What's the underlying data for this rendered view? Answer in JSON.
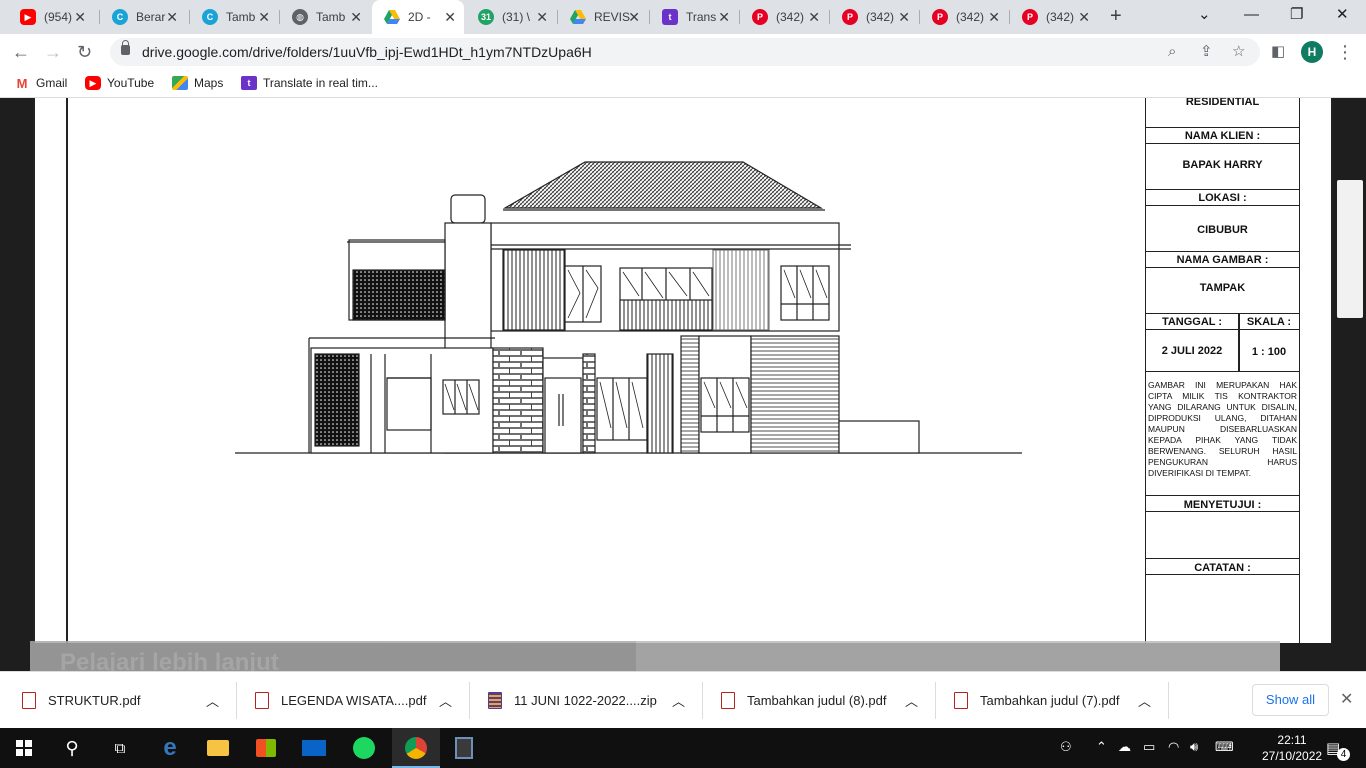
{
  "tabs": [
    {
      "title": "(954)",
      "icon": "youtube-icon",
      "color": "#ff0000"
    },
    {
      "title": "Berar",
      "icon": "canva-icon",
      "color": "#1aa3d6"
    },
    {
      "title": "Tamb",
      "icon": "canva-icon",
      "color": "#1aa3d6"
    },
    {
      "title": "Tamb",
      "icon": "globe-icon",
      "color": "#5f6368"
    },
    {
      "title": "2D -",
      "icon": "google-drive-icon",
      "color": "#1fa463",
      "active": true
    },
    {
      "title": "(31) \\",
      "icon": "calendar-icon",
      "color": "#21a366"
    },
    {
      "title": "REVIS",
      "icon": "google-drive-icon",
      "color": "#1fa463"
    },
    {
      "title": "Trans",
      "icon": "translate-icon",
      "color": "#6a32c9"
    },
    {
      "title": "(342)",
      "icon": "pinterest-icon",
      "color": "#e60023"
    },
    {
      "title": "(342)",
      "icon": "pinterest-icon",
      "color": "#e60023"
    },
    {
      "title": "(342)",
      "icon": "pinterest-icon",
      "color": "#e60023"
    },
    {
      "title": "(342)",
      "icon": "pinterest-icon",
      "color": "#e60023"
    }
  ],
  "toolbar": {
    "url": "drive.google.com/drive/folders/1uuVfb_ipj-Ewd1HDt_h1ym7NTDzUpa6H",
    "avatar_letter": "H"
  },
  "bookmarks": [
    {
      "label": "Gmail",
      "icon": "gmail-icon"
    },
    {
      "label": "YouTube",
      "icon": "youtube-icon"
    },
    {
      "label": "Maps",
      "icon": "maps-icon"
    },
    {
      "label": "Translate in real tim...",
      "icon": "translate-icon"
    }
  ],
  "title_block": {
    "project_type": "RESIDENTIAL",
    "client_label": "NAMA KLIEN :",
    "client_value": "BAPAK HARRY",
    "location_label": "LOKASI :",
    "location_value": "CIBUBUR",
    "drawing_label": "NAMA GAMBAR :",
    "drawing_value": "TAMPAK",
    "date_label": "TANGGAL :",
    "date_value": "2 JULI 2022",
    "scale_label": "SKALA :",
    "scale_value": "1 : 100",
    "copyright_note": "GAMBAR INI MERUPAKAN HAK CIPTA MILIK TIS KONTRAKTOR YANG DILARANG UNTUK DISALIN, DIPRODUKSI ULANG, DITAHAN MAUPUN DISEBARLUASKAN KEPADA PIHAK YANG TIDAK BERWENANG. SELURUH HASIL PENGUKURAN HARUS DIVERIFIKASI DI TEMPAT.",
    "approval_label": "MENYETUJUI :",
    "notes_label": "CATATAN :"
  },
  "learn_more_text": "Pelajari lebih lanjut",
  "downloads": [
    {
      "name": "STRUKTUR.pdf",
      "icon": "pdf-icon"
    },
    {
      "name": "LEGENDA WISATA....pdf",
      "icon": "pdf-icon"
    },
    {
      "name": "11 JUNI 1022-2022....zip",
      "icon": "zip-icon"
    },
    {
      "name": "Tambahkan judul (8).pdf",
      "icon": "pdf-icon"
    },
    {
      "name": "Tambahkan judul (7).pdf",
      "icon": "pdf-icon"
    }
  ],
  "show_all_label": "Show all",
  "taskbar": {
    "time": "22:11",
    "date": "27/10/2022",
    "notification_count": "4"
  }
}
